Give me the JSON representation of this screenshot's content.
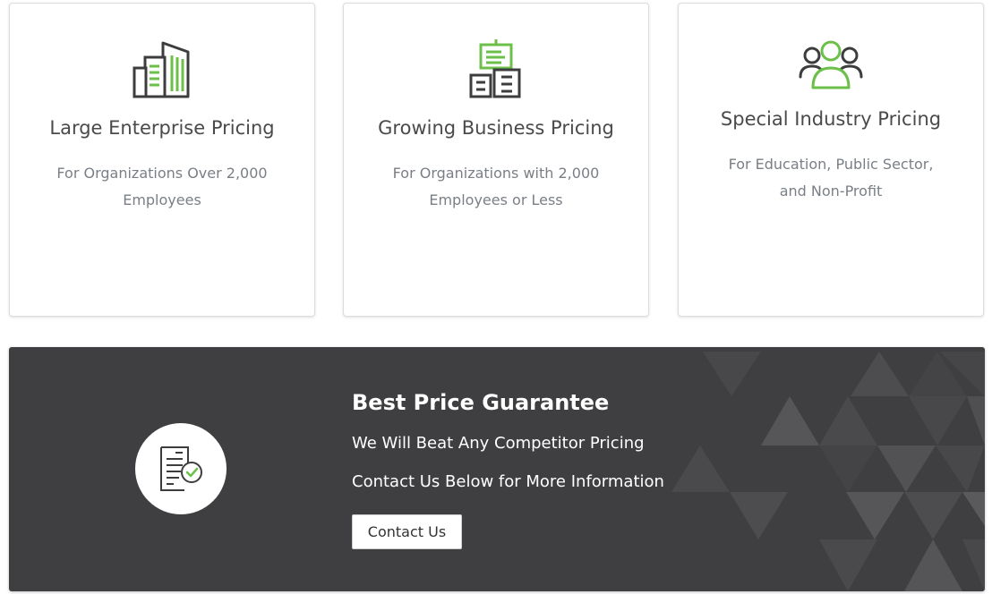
{
  "cards": [
    {
      "icon": "building-icon",
      "title": "Large Enterprise Pricing",
      "description": "For Organizations Over 2,000 Employees"
    },
    {
      "icon": "business-buildings-icon",
      "title": "Growing Business Pricing",
      "description": "For Organizations with 2,000 Employees or Less"
    },
    {
      "icon": "users-group-icon",
      "title": "Special Industry Pricing",
      "description": "For Education, Public Sector, and Non-Profit"
    }
  ],
  "banner": {
    "icon": "document-check-icon",
    "title": "Best Price Guarantee",
    "line1": "We Will Beat Any Competitor Pricing",
    "line2": "Contact Us Below for More Information",
    "button_label": "Contact Us"
  },
  "colors": {
    "accent_green": "#6cc04a",
    "icon_dark": "#3d3d3f",
    "banner_bg": "#3f3f41",
    "title_text": "#4a4a4a",
    "desc_text": "#7a7f86"
  }
}
